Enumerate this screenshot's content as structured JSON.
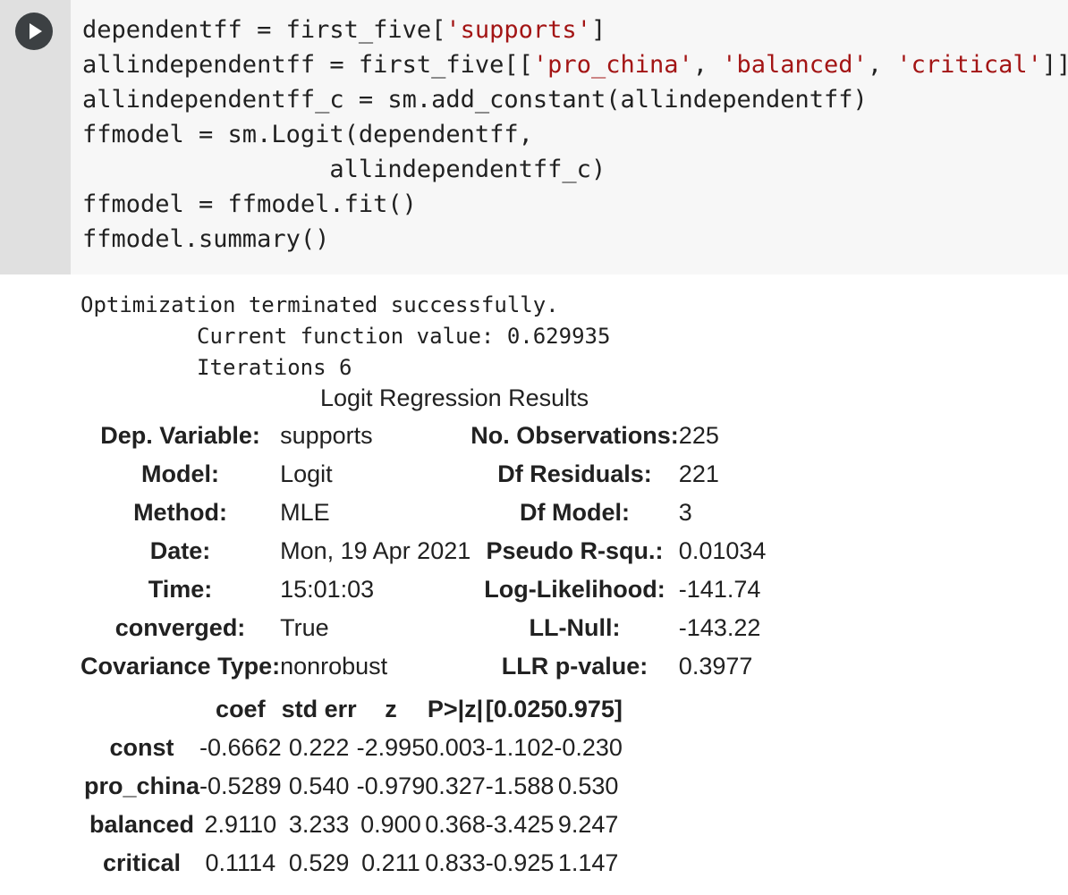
{
  "code_cell": {
    "run_button_icon": "play-icon",
    "lines": [
      [
        {
          "t": "dependentff = first_five["
        },
        {
          "s": "'supports'"
        },
        {
          "t": "]"
        }
      ],
      [
        {
          "t": "allindependentff = first_five[["
        },
        {
          "s": "'pro_china'"
        },
        {
          "t": ", "
        },
        {
          "s": "'balanced'"
        },
        {
          "t": ", "
        },
        {
          "s": "'critical'"
        },
        {
          "t": "]]"
        }
      ],
      [
        {
          "t": "allindependentff_c = sm.add_constant(allindependentff)"
        }
      ],
      [
        {
          "t": "ffmodel = sm.Logit(dependentff,"
        }
      ],
      [
        {
          "t": "                 allindependentff_c)"
        }
      ],
      [
        {
          "t": "ffmodel = ffmodel.fit()"
        }
      ],
      [
        {
          "t": "ffmodel.summary()"
        }
      ]
    ]
  },
  "output": {
    "stdout": "Optimization terminated successfully.\n         Current function value: 0.629935\n         Iterations 6",
    "caption": "Logit Regression Results",
    "summary_rows": [
      {
        "label1": "Dep. Variable:",
        "value1": "supports",
        "label2": "No. Observations:",
        "value2": "225"
      },
      {
        "label1": "Model:",
        "value1": "Logit",
        "label2": "Df Residuals:",
        "value2": "221"
      },
      {
        "label1": "Method:",
        "value1": "MLE",
        "label2": "Df Model:",
        "value2": "3"
      },
      {
        "label1": "Date:",
        "value1": "Mon, 19 Apr 2021",
        "label2": "Pseudo R-squ.:",
        "value2": "0.01034"
      },
      {
        "label1": "Time:",
        "value1": "15:01:03",
        "label2": "Log-Likelihood:",
        "value2": "-141.74"
      },
      {
        "label1": "converged:",
        "value1": "True",
        "label2": "LL-Null:",
        "value2": "-143.22"
      },
      {
        "label1": "Covariance Type:",
        "value1": "nonrobust",
        "label2": "LLR p-value:",
        "value2": "0.3977"
      }
    ],
    "coef_headers": [
      "",
      "coef",
      "std err",
      "z",
      "P>|z|",
      "[0.025",
      "0.975]"
    ],
    "coef_rows": [
      [
        "const",
        "-0.6662",
        "0.222",
        "-2.995",
        "0.003",
        "-1.102",
        "-0.230"
      ],
      [
        "pro_china",
        "-0.5289",
        "0.540",
        "-0.979",
        "0.327",
        "-1.588",
        "0.530"
      ],
      [
        "balanced",
        "2.9110",
        "3.233",
        "0.900",
        "0.368",
        "-3.425",
        "9.247"
      ],
      [
        "critical",
        "0.1114",
        "0.529",
        "0.211",
        "0.833",
        "-0.925",
        "1.147"
      ]
    ]
  }
}
